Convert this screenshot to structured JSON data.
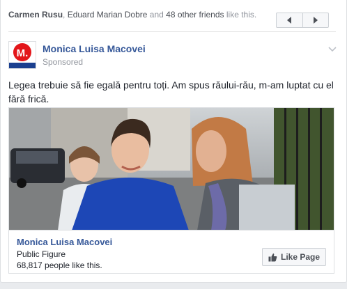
{
  "social_context": {
    "friend_1": "Carmen Rusu",
    "separator_1": ", ",
    "friend_2": "Eduard Marian Dobre",
    "middle": " and ",
    "others": "48 other friends",
    "suffix": " like this."
  },
  "post": {
    "author": "Monica Luisa Macovei",
    "sponsored": "Sponsored",
    "text": "Legea trebuie să fie egală pentru toți. Am spus răului-rău, m-am luptat cu el fără frică.",
    "avatar_letter": "M."
  },
  "page_card": {
    "name": "Monica Luisa Macovei",
    "category": "Public Figure",
    "likes": "68,817 people like this.",
    "like_button": "Like Page"
  },
  "colors": {
    "link": "#365899",
    "muted": "#90949c",
    "avatar_red": "#e3161a",
    "avatar_blue": "#1b3f8f"
  },
  "icons": {
    "pager_prev": "triangle-left",
    "pager_next": "triangle-right",
    "menu": "chevron-down",
    "like": "thumbs-up"
  }
}
